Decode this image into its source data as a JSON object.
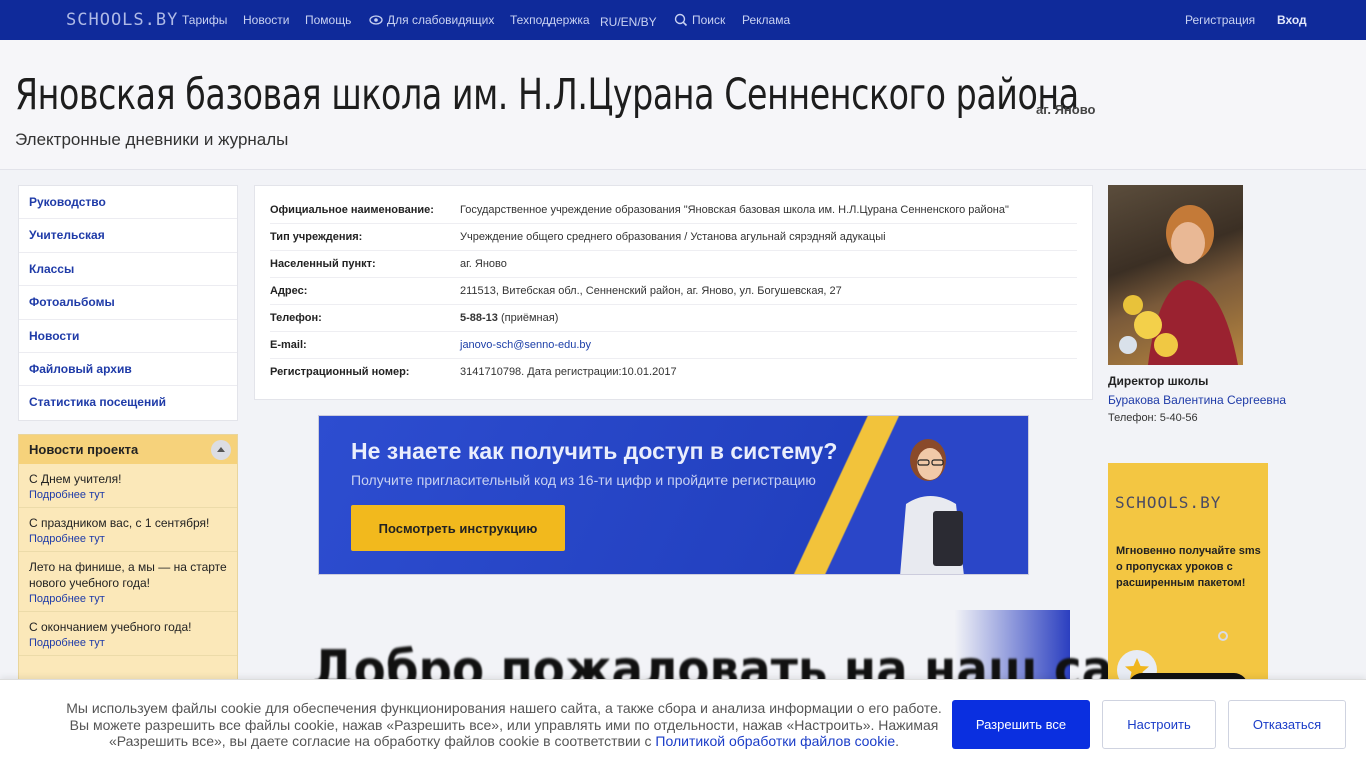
{
  "topbar": {
    "logo": "SCHOOLS.BY",
    "nav": [
      "Тарифы",
      "Новости",
      "Помощь",
      "Для слабовидящих",
      "Техподдержка",
      "RU/EN/BY",
      "Поиск",
      "Реклама"
    ],
    "register": "Регистрация",
    "login": "Вход"
  },
  "header": {
    "title": "Яновская базовая школа им. Н.Л.Цурана Сенненского района",
    "locality": "аг. Яново",
    "subtitle": "Электронные дневники и журналы"
  },
  "menu": [
    "Руководство",
    "Учительская",
    "Классы",
    "Фотоальбомы",
    "Новости",
    "Файловый архив",
    "Статистика посещений"
  ],
  "news": {
    "title": "Новости проекта",
    "more": "Подробнее тут",
    "items": [
      "С Днем учителя!",
      "С праздником вас, с 1 сентября!",
      "Лето на финише, а мы — на старте нового учебного года!",
      "С окончанием учебного года!"
    ]
  },
  "info": {
    "rows": [
      {
        "label": "Официальное наименование:",
        "value": "Государственное учреждение образования \"Яновская базовая школа им. Н.Л.Цурана Сенненского района\""
      },
      {
        "label": "Тип учреждения:",
        "value": "Учреждение общего среднего образования / Установа агульнай сярэдняй адукацыі"
      },
      {
        "label": "Населенный пункт:",
        "value": "аг. Яново"
      },
      {
        "label": "Адрес:",
        "value": "211513, Витебская обл., Сенненский район, аг. Яново, ул. Богушевская, 27"
      },
      {
        "label": "Телефон:",
        "value_bold": "5-88-13",
        "value_extra": "(приёмная)"
      },
      {
        "label": "E-mail:",
        "value": "janovo-sch@senno-edu.by"
      },
      {
        "label": "Регистрационный номер:",
        "value": "3141710798. Дата регистрации:10.01.2017"
      }
    ]
  },
  "banner": {
    "heading": "Не знаете как получить доступ в систему?",
    "sub": "Получите пригласительный код из 16-ти цифр и пройдите регистрацию",
    "button": "Посмотреть инструкцию"
  },
  "welcome": "Добро пожаловать на наш сайт!",
  "director": {
    "role": "Директор школы",
    "name": "Буракова Валентина Сергеевна",
    "phone": "Телефон: 5-40-56"
  },
  "ad": {
    "logo": "SCHOOLS.BY",
    "text": "Мгновенно получайте sms о пропусках уроков с расширенным пакетом!"
  },
  "cookie": {
    "text": "Мы используем файлы cookie для обеспечения функционирования нашего сайта, а также сбора и анализа информации о его работе. Вы можете разрешить все файлы cookie, нажав «Разрешить все», или управлять ими по отдельности, нажав «Настроить». Нажимая «Разрешить все», вы даете согласие на обработку файлов cookie в соответствии с",
    "link": "Политикой обработки файлов cookie",
    "end": ".",
    "allow": "Разрешить все",
    "settings": "Настроить",
    "refuse": "Отказаться"
  },
  "colors": {
    "topbar": "#0f2a9a",
    "accent_button": "#0a2fe0",
    "news_panel": "#fbe8b9",
    "banner_button": "#f2b91d"
  }
}
